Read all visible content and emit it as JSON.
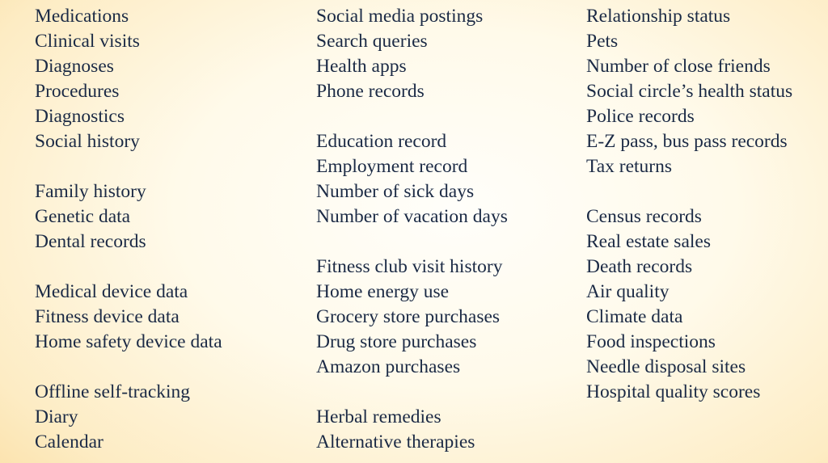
{
  "columns": [
    {
      "lines": [
        "Medications",
        "Clinical visits",
        "Diagnoses",
        "Procedures",
        "Diagnostics",
        "Social history",
        "",
        "Family history",
        "Genetic data",
        "Dental records",
        "",
        "Medical device data",
        "Fitness device data",
        "Home safety device data",
        "",
        "Offline self-tracking",
        "Diary",
        "Calendar"
      ]
    },
    {
      "lines": [
        "Social media postings",
        "Search queries",
        "Health apps",
        "Phone records",
        "",
        "Education record",
        "Employment record",
        "Number of sick days",
        "Number of vacation days",
        "",
        "Fitness club visit history",
        "Home energy use",
        "Grocery store purchases",
        "Drug store purchases",
        "Amazon purchases",
        "",
        "Herbal remedies",
        "Alternative therapies"
      ]
    },
    {
      "lines": [
        "Relationship status",
        "Pets",
        "Number of close friends",
        "Social circle’s health status",
        "Police records",
        "E-Z pass, bus pass records",
        "Tax returns",
        "",
        "Census records",
        "Real estate sales",
        "Death records",
        "Air quality",
        "Climate data",
        "Food inspections",
        "Needle disposal sites",
        "Hospital quality scores"
      ]
    }
  ],
  "colors": {
    "text": "#1b2a45",
    "background_center": "#fffefa",
    "background_edge": "#fbe2ac"
  }
}
